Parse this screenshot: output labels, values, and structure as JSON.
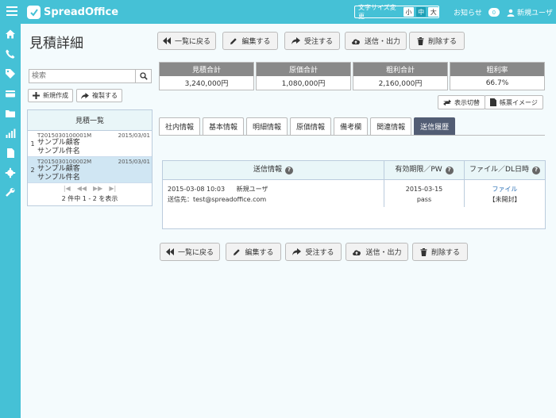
{
  "header": {
    "brand": "SpreadOffice",
    "font_size_label": "文字サイズ変更",
    "font_sizes": [
      "小",
      "中",
      "大"
    ],
    "notice_label": "お知らせ",
    "notice_count": "0",
    "user_name": "新規ユーザ"
  },
  "page": {
    "title": "見積詳細"
  },
  "actions": {
    "back": "一覧に戻る",
    "edit": "編集する",
    "order": "受注する",
    "send": "送信・出力",
    "delete": "削除する"
  },
  "search": {
    "placeholder": "検索"
  },
  "list_actions": {
    "create": "新規作成",
    "copy": "複製する"
  },
  "estimate_list": {
    "title": "見積一覧",
    "rows": [
      {
        "num": "1",
        "code": "T2015030100001M",
        "date": "2015/03/01",
        "customer": "サンプル顧客",
        "subject": "サンプル件名"
      },
      {
        "num": "2",
        "code": "T2015030100002M",
        "date": "2015/03/01",
        "customer": "サンプル顧客",
        "subject": "サンプル件名"
      }
    ],
    "pager_info": "2 件中 1 - 2 を表示"
  },
  "summary": [
    {
      "label": "見積合計",
      "value": "3,240,000円"
    },
    {
      "label": "原価合計",
      "value": "1,080,000円"
    },
    {
      "label": "粗利合計",
      "value": "2,160,000円"
    },
    {
      "label": "粗利率",
      "value": "66.7%"
    }
  ],
  "tools": {
    "display_switch": "表示切替",
    "form_image": "帳票イメージ"
  },
  "tabs": [
    "社内情報",
    "基本情報",
    "明細情報",
    "原価情報",
    "備考欄",
    "関連情報",
    "送信履歴"
  ],
  "send_history": {
    "headers": [
      "送信情報",
      "有効期限／PW",
      "ファイル／DL日時"
    ],
    "row": {
      "datetime": "2015-03-08 10:03",
      "user": "新規ユーザ",
      "dest": "送信先：test@spreadoffice.com",
      "expiry": "2015-03-15",
      "pw": "pass",
      "file": "ファイル",
      "status": "【未開封】"
    }
  },
  "colors": {
    "accent": "#45c1d6",
    "active_tab": "#525d74",
    "summary_header": "#898989"
  }
}
